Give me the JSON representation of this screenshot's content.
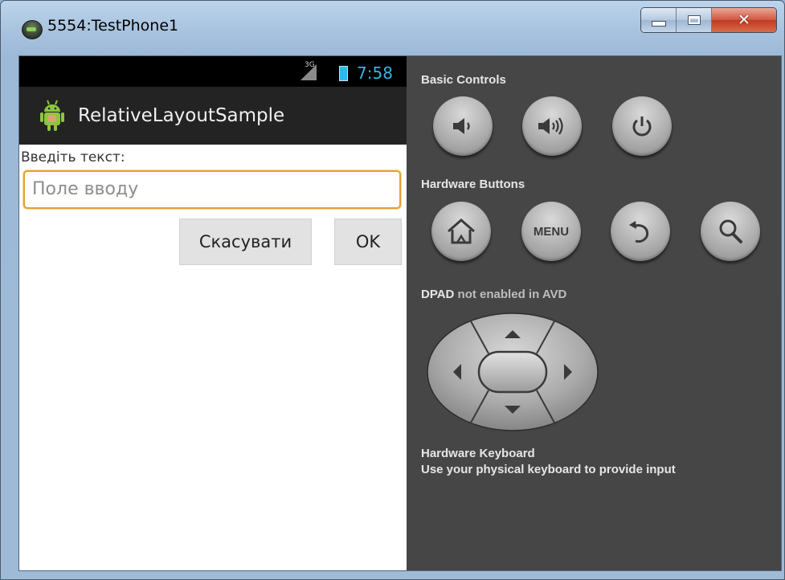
{
  "window": {
    "title": "5554:TestPhone1",
    "icon": "android-emulator-icon",
    "controls": [
      "minimize",
      "maximize",
      "close"
    ]
  },
  "phone": {
    "status_bar": {
      "network": "3G",
      "time": "7:58"
    },
    "action_bar": {
      "title": "RelativeLayoutSample",
      "icon": "android-robot-icon"
    },
    "label": "Введіть текст:",
    "input": {
      "placeholder": "Поле вводу",
      "value": ""
    },
    "buttons": {
      "cancel": "Скасувати",
      "ok": "OK"
    }
  },
  "controls_panel": {
    "basic_controls": {
      "heading": "Basic Controls",
      "buttons": [
        "volume-down-icon",
        "volume-up-icon",
        "power-icon"
      ]
    },
    "hardware_buttons": {
      "heading": "Hardware Buttons",
      "buttons": [
        "home-icon",
        "menu-icon",
        "back-icon",
        "search-icon"
      ],
      "menu_label": "MENU"
    },
    "dpad": {
      "heading_strong": "DPAD",
      "heading_rest": " not enabled in AVD"
    },
    "keyboard": {
      "heading": "Hardware Keyboard",
      "text": "Use your physical keyboard to provide input"
    }
  },
  "colors": {
    "panel_bg": "#464646",
    "holo_blue": "#33b5e5",
    "input_focus": "#e3a130",
    "action_bar": "#232323"
  }
}
